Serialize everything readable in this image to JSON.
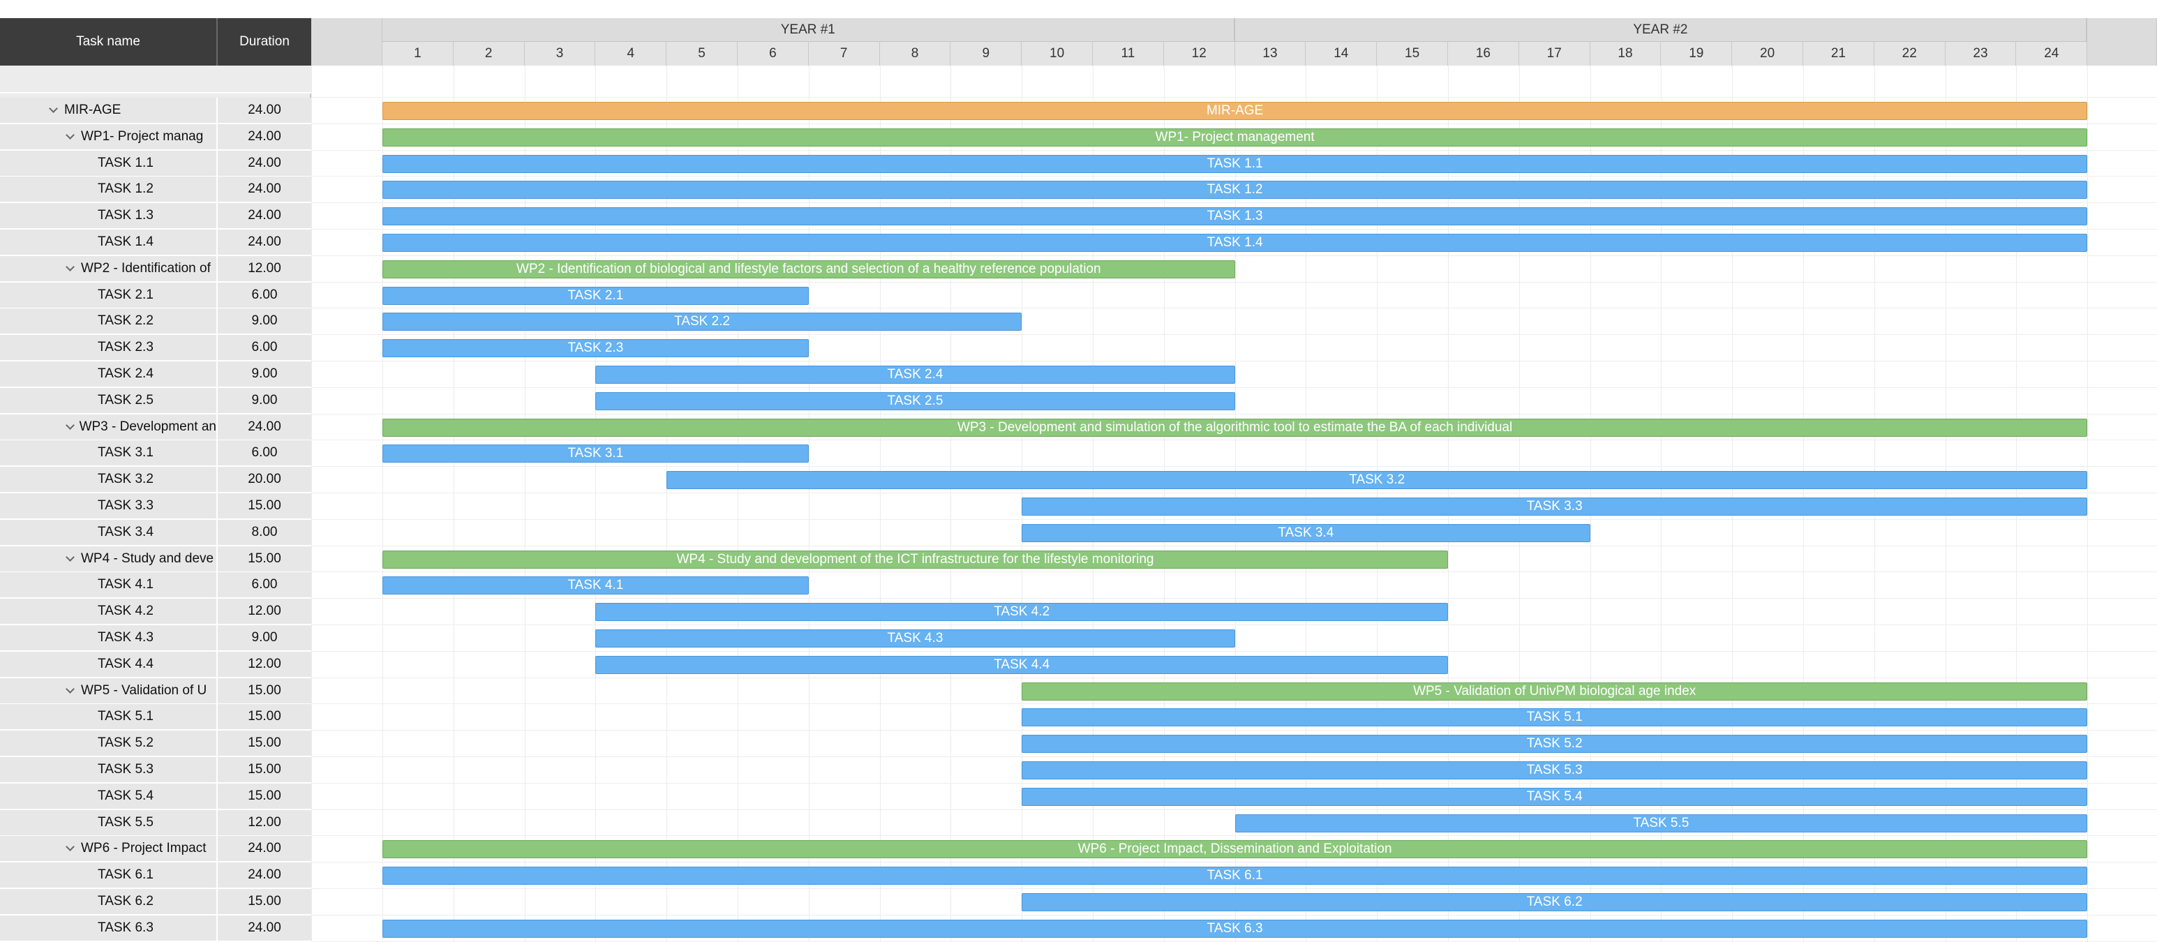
{
  "header": {
    "task_name_label": "Task name",
    "duration_label": "Duration",
    "years": [
      "YEAR #1",
      "YEAR #2"
    ],
    "months": [
      "1",
      "2",
      "3",
      "4",
      "5",
      "6",
      "7",
      "8",
      "9",
      "10",
      "11",
      "12",
      "13",
      "14",
      "15",
      "16",
      "17",
      "18",
      "19",
      "20",
      "21",
      "22",
      "23",
      "24"
    ]
  },
  "rows": [
    {
      "level": 0,
      "name": "MIR-AGE",
      "duration": "24.00",
      "bar_label": "MIR-AGE",
      "kind": "project",
      "start": 1,
      "months": 24,
      "collapsible": true
    },
    {
      "level": 1,
      "name": "WP1- Project manag",
      "duration": "24.00",
      "bar_label": "WP1- Project management",
      "kind": "wp",
      "start": 1,
      "months": 24,
      "collapsible": true
    },
    {
      "level": 2,
      "name": "TASK 1.1",
      "duration": "24.00",
      "bar_label": "TASK 1.1",
      "kind": "task",
      "start": 1,
      "months": 24
    },
    {
      "level": 2,
      "name": "TASK 1.2",
      "duration": "24.00",
      "bar_label": "TASK 1.2",
      "kind": "task",
      "start": 1,
      "months": 24
    },
    {
      "level": 2,
      "name": "TASK 1.3",
      "duration": "24.00",
      "bar_label": "TASK 1.3",
      "kind": "task",
      "start": 1,
      "months": 24
    },
    {
      "level": 2,
      "name": "TASK 1.4",
      "duration": "24.00",
      "bar_label": "TASK 1.4",
      "kind": "task",
      "start": 1,
      "months": 24
    },
    {
      "level": 1,
      "name": "WP2 - Identification of",
      "duration": "12.00",
      "bar_label": "WP2 - Identification of biological and lifestyle factors and selection of a healthy reference population",
      "kind": "wp",
      "start": 1,
      "months": 12,
      "collapsible": true
    },
    {
      "level": 2,
      "name": "TASK 2.1",
      "duration": "6.00",
      "bar_label": "TASK 2.1",
      "kind": "task",
      "start": 1,
      "months": 6
    },
    {
      "level": 2,
      "name": "TASK 2.2",
      "duration": "9.00",
      "bar_label": "TASK 2.2",
      "kind": "task",
      "start": 1,
      "months": 9
    },
    {
      "level": 2,
      "name": "TASK 2.3",
      "duration": "6.00",
      "bar_label": "TASK 2.3",
      "kind": "task",
      "start": 1,
      "months": 6
    },
    {
      "level": 2,
      "name": "TASK 2.4",
      "duration": "9.00",
      "bar_label": "TASK 2.4",
      "kind": "task",
      "start": 4,
      "months": 9
    },
    {
      "level": 2,
      "name": "TASK 2.5",
      "duration": "9.00",
      "bar_label": "TASK 2.5",
      "kind": "task",
      "start": 4,
      "months": 9
    },
    {
      "level": 1,
      "name": "WP3 - Development an",
      "duration": "24.00",
      "bar_label": "WP3 - Development and simulation of the algorithmic tool to estimate the BA of each individual",
      "kind": "wp",
      "start": 1,
      "months": 24,
      "collapsible": true
    },
    {
      "level": 2,
      "name": "TASK 3.1",
      "duration": "6.00",
      "bar_label": "TASK 3.1",
      "kind": "task",
      "start": 1,
      "months": 6
    },
    {
      "level": 2,
      "name": "TASK 3.2",
      "duration": "20.00",
      "bar_label": "TASK 3.2",
      "kind": "task",
      "start": 5,
      "months": 20
    },
    {
      "level": 2,
      "name": "TASK 3.3",
      "duration": "15.00",
      "bar_label": "TASK 3.3",
      "kind": "task",
      "start": 10,
      "months": 15
    },
    {
      "level": 2,
      "name": "TASK 3.4",
      "duration": "8.00",
      "bar_label": "TASK 3.4",
      "kind": "task",
      "start": 10,
      "months": 8
    },
    {
      "level": 1,
      "name": "WP4 - Study and deve",
      "duration": "15.00",
      "bar_label": "WP4 - Study and development of the ICT infrastructure for the lifestyle monitoring",
      "kind": "wp",
      "start": 1,
      "months": 15,
      "collapsible": true
    },
    {
      "level": 2,
      "name": "TASK 4.1",
      "duration": "6.00",
      "bar_label": "TASK 4.1",
      "kind": "task",
      "start": 1,
      "months": 6
    },
    {
      "level": 2,
      "name": "TASK 4.2",
      "duration": "12.00",
      "bar_label": "TASK 4.2",
      "kind": "task",
      "start": 4,
      "months": 12
    },
    {
      "level": 2,
      "name": "TASK 4.3",
      "duration": "9.00",
      "bar_label": "TASK 4.3",
      "kind": "task",
      "start": 4,
      "months": 9
    },
    {
      "level": 2,
      "name": "TASK 4.4",
      "duration": "12.00",
      "bar_label": "TASK 4.4",
      "kind": "task",
      "start": 4,
      "months": 12
    },
    {
      "level": 1,
      "name": "WP5 - Validation of U",
      "duration": "15.00",
      "bar_label": "WP5 - Validation of UnivPM biological age index",
      "kind": "wp",
      "start": 10,
      "months": 15,
      "collapsible": true
    },
    {
      "level": 2,
      "name": "TASK 5.1",
      "duration": "15.00",
      "bar_label": "TASK 5.1",
      "kind": "task",
      "start": 10,
      "months": 15
    },
    {
      "level": 2,
      "name": "TASK 5.2",
      "duration": "15.00",
      "bar_label": "TASK 5.2",
      "kind": "task",
      "start": 10,
      "months": 15
    },
    {
      "level": 2,
      "name": "TASK 5.3",
      "duration": "15.00",
      "bar_label": "TASK 5.3",
      "kind": "task",
      "start": 10,
      "months": 15
    },
    {
      "level": 2,
      "name": "TASK 5.4",
      "duration": "15.00",
      "bar_label": "TASK 5.4",
      "kind": "task",
      "start": 10,
      "months": 15
    },
    {
      "level": 2,
      "name": "TASK 5.5",
      "duration": "12.00",
      "bar_label": "TASK 5.5",
      "kind": "task",
      "start": 13,
      "months": 12
    },
    {
      "level": 1,
      "name": "WP6 - Project Impact",
      "duration": "24.00",
      "bar_label": "WP6 - Project Impact, Dissemination and Exploitation",
      "kind": "wp",
      "start": 1,
      "months": 24,
      "collapsible": true
    },
    {
      "level": 2,
      "name": "TASK 6.1",
      "duration": "24.00",
      "bar_label": "TASK 6.1",
      "kind": "task",
      "start": 1,
      "months": 24
    },
    {
      "level": 2,
      "name": "TASK 6.2",
      "duration": "15.00",
      "bar_label": "TASK 6.2",
      "kind": "task",
      "start": 10,
      "months": 15
    },
    {
      "level": 2,
      "name": "TASK 6.3",
      "duration": "24.00",
      "bar_label": "TASK 6.3",
      "kind": "task",
      "start": 1,
      "months": 24
    }
  ],
  "colors": {
    "project": "#f0b56a",
    "wp": "#8cc77b",
    "task": "#66b2f2",
    "grid_header": "#3c3c3c"
  }
}
